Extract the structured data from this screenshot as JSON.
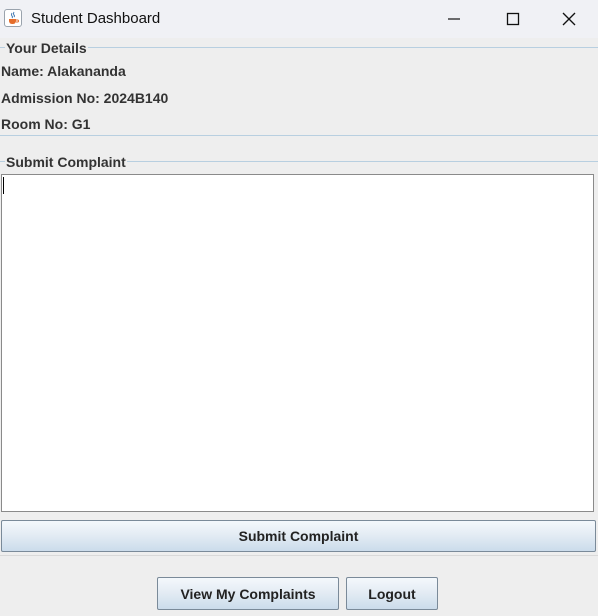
{
  "window": {
    "title": "Student Dashboard",
    "icon": "java-cup-icon"
  },
  "details": {
    "group_title": "Your Details",
    "name": "Name: Alakananda",
    "admission": "Admission No: 2024B140",
    "room": "Room No: G1"
  },
  "complaint": {
    "group_title": "Submit Complaint",
    "text": "",
    "submit_label": "Submit Complaint"
  },
  "actions": {
    "view_label": "View My Complaints",
    "logout_label": "Logout"
  },
  "colors": {
    "group_border": "#b8cfe0",
    "button_gradient_top": "#f4f8fc",
    "button_gradient_bottom": "#cbdceb",
    "background": "#eeeeee"
  }
}
